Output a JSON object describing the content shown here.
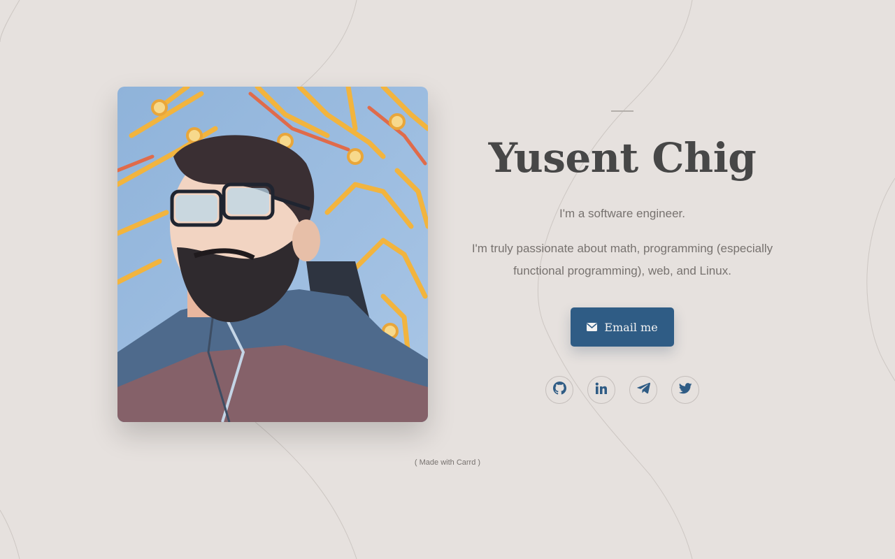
{
  "profile": {
    "name": "Yusent Chig",
    "tagline": "I'm a software engineer.",
    "bio": "I'm truly passionate about math, programming (especially functional programming), web, and Linux."
  },
  "cta": {
    "label": "Email me",
    "icon": "envelope-icon"
  },
  "socials": [
    {
      "name": "github",
      "icon": "github-icon"
    },
    {
      "name": "linkedin",
      "icon": "linkedin-icon"
    },
    {
      "name": "telegram",
      "icon": "telegram-icon"
    },
    {
      "name": "twitter",
      "icon": "twitter-icon"
    }
  ],
  "footer": {
    "text": "( Made with Carrd )"
  },
  "colors": {
    "background": "#e6e1de",
    "accent": "#2f5c85",
    "heading": "#474747",
    "body_text": "#77726f"
  }
}
